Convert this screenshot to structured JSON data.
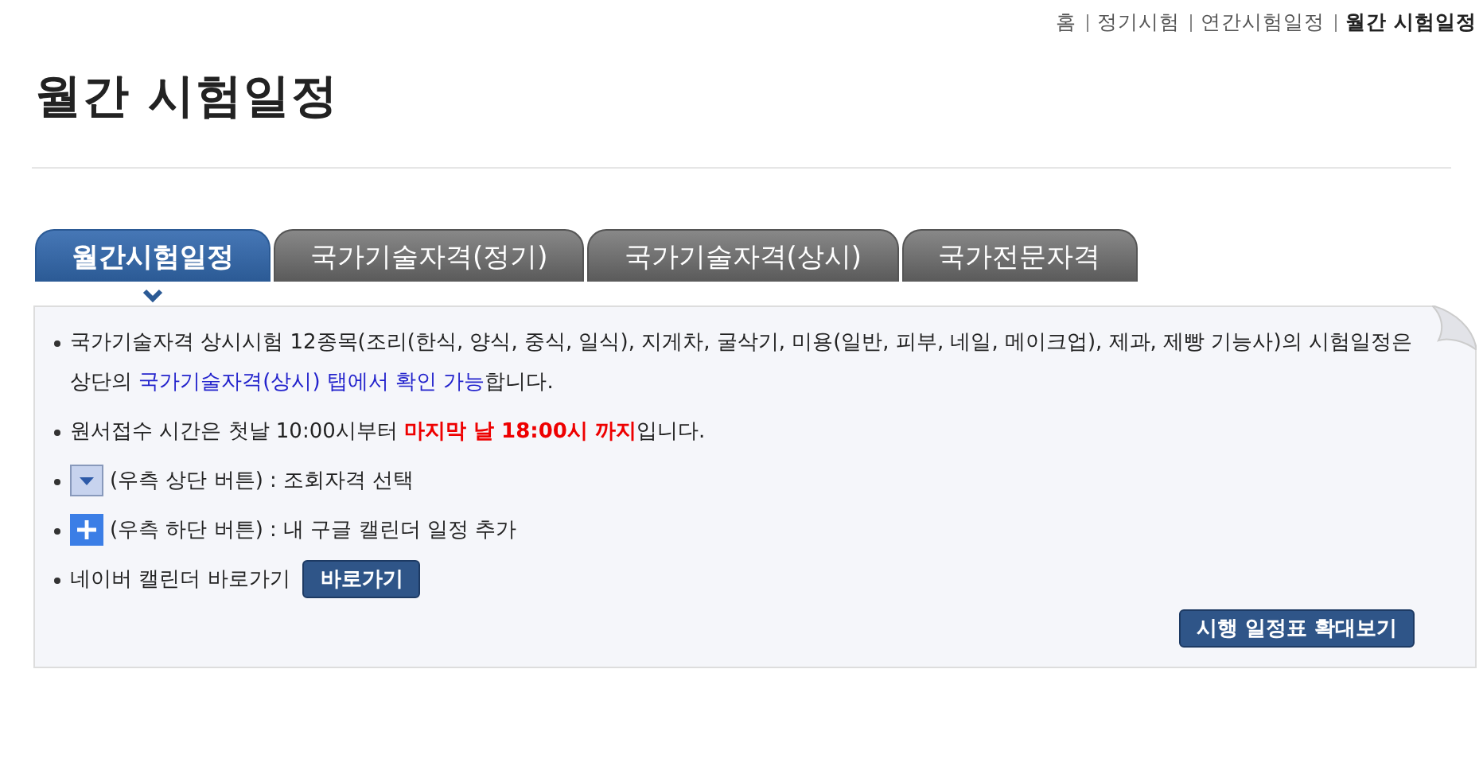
{
  "breadcrumb": [
    {
      "label": "홈",
      "selected": false
    },
    {
      "label": "정기시험",
      "selected": false
    },
    {
      "label": "연간시험일정",
      "selected": false
    },
    {
      "label": "월간 시험일정",
      "selected": true
    }
  ],
  "page_title": "월간 시험일정",
  "tabs": [
    {
      "label": "월간시험일정",
      "selected": true
    },
    {
      "label": "국가기술자격(정기)",
      "selected": false
    },
    {
      "label": "국가기술자격(상시)",
      "selected": false
    },
    {
      "label": "국가전문자격",
      "selected": false
    }
  ],
  "notes": [
    {
      "parts": [
        {
          "kind": "text",
          "text": "국가기술자격 상시시험 12종목(조리(한식, 양식, 중식, 일식), 지게차, 굴삭기, 미용(일반, 피부, 네일, 메이크업), 제과, 제빵 기능사)의 시험일정은 상단의 "
        },
        {
          "kind": "link",
          "text": "국가기술자격(상시) 탭에서 확인 가능"
        },
        {
          "kind": "text",
          "text": "합니다."
        }
      ]
    },
    {
      "parts": [
        {
          "kind": "text",
          "text": "원서접수 시간은 첫날 10:00시부터 "
        },
        {
          "kind": "emphasis",
          "text": "마지막 날 18:00시 까지"
        },
        {
          "kind": "text",
          "text": "입니다."
        }
      ]
    },
    {
      "parts": [
        {
          "kind": "down-icon"
        },
        {
          "kind": "text",
          "text": "(우측 상단 버튼) : 조회자격 선택"
        }
      ]
    },
    {
      "parts": [
        {
          "kind": "plus-icon"
        },
        {
          "kind": "text",
          "text": "(우측 하단 버튼) : 내 구글 캘린더 일정 추가"
        }
      ]
    },
    {
      "parts": [
        {
          "kind": "text",
          "text": "네이버 캘린더 바로가기"
        },
        {
          "kind": "button",
          "text": "바로가기"
        }
      ]
    }
  ],
  "zoom_button": "시행 일정표 확대보기"
}
